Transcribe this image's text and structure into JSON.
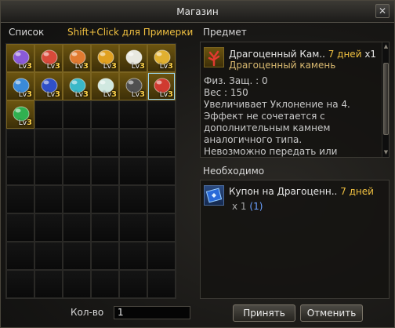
{
  "window": {
    "title": "Магазин",
    "close_glyph": "✕"
  },
  "list": {
    "header": "Список",
    "hint": "Shift+Click для Примерки",
    "items": [
      {
        "icon": "purple-gem-icon",
        "color": "#8a5ad8",
        "level": "3"
      },
      {
        "icon": "red-gem-icon",
        "color": "#d84a3a",
        "level": "3"
      },
      {
        "icon": "orange-gem-icon",
        "color": "#e07a30",
        "level": "3"
      },
      {
        "icon": "amber-gem-icon",
        "color": "#e0a020",
        "level": "3"
      },
      {
        "icon": "pearl-icon",
        "color": "#e8e8e0",
        "level": "3"
      },
      {
        "icon": "gold-ring-icon",
        "color": "#e0b030",
        "level": "3"
      },
      {
        "icon": "blue-topaz-icon",
        "color": "#3a8ad8",
        "level": "3"
      },
      {
        "icon": "sapphire-icon",
        "color": "#3050c8",
        "level": "3"
      },
      {
        "icon": "aquamarine-icon",
        "color": "#3ab8c8",
        "level": "3"
      },
      {
        "icon": "diamond-icon",
        "color": "#d0e8e0",
        "level": "3"
      },
      {
        "icon": "obsidian-icon",
        "color": "#505050",
        "level": "3"
      },
      {
        "icon": "coral-icon",
        "color": "#d03a30",
        "level": "3"
      },
      {
        "icon": "emerald-icon",
        "color": "#30b050",
        "level": "3"
      }
    ],
    "level_prefix": "Lv",
    "selected_index": 11,
    "total_slots": 54
  },
  "item": {
    "header": "Предмет",
    "name": "Драгоценный Кам..",
    "duration": "7 дней",
    "count": "x1",
    "subtitle": "Драгоценный камень",
    "phys_def": "Физ. Защ. : 0",
    "weight": "Вес : 150",
    "desc_lines": [
      "Увеличивает Уклонение на 4.",
      "Эффект не сочетается с",
      "дополнительным камнем",
      "аналогичного типа.",
      "Невозможно передать или"
    ]
  },
  "required": {
    "header": "Необходимо",
    "name": "Купон на Драгоценн..",
    "duration": "7 дней",
    "amount": "x 1",
    "owned": "(1)"
  },
  "quantity": {
    "label": "Кол-во",
    "value": "1"
  },
  "buttons": {
    "accept": "Принять",
    "cancel": "Отменить"
  },
  "colors": {
    "hint": "#f0c040",
    "duration": "#f0c040",
    "owned": "#6aa0ff",
    "selected_border": "#9dd8f0"
  }
}
